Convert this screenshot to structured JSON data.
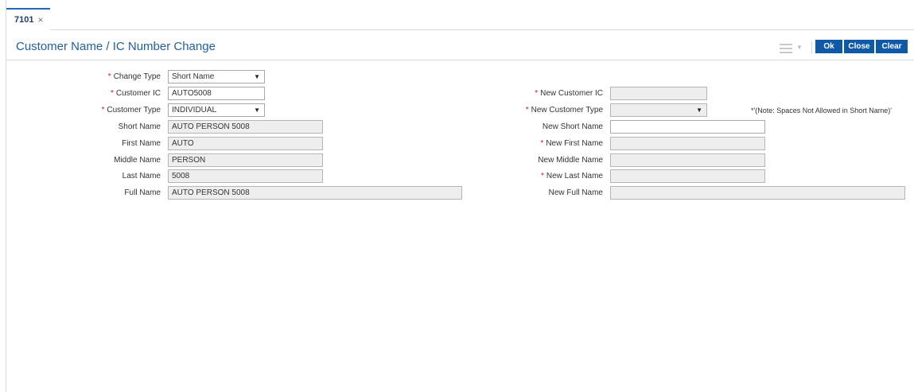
{
  "tab": {
    "label": "7101",
    "close": "×"
  },
  "header": {
    "title": "Customer Name / IC Number Change"
  },
  "toolbar": {
    "ok": "Ok",
    "close": "Close",
    "clear": "Clear"
  },
  "req_mark": "*",
  "form": {
    "change_type": {
      "label": "Change Type",
      "value": "Short Name"
    },
    "customer_ic": {
      "label": "Customer IC",
      "value": "AUTO5008"
    },
    "customer_type": {
      "label": "Customer Type",
      "value": "INDIVIDUAL"
    },
    "short_name": {
      "label": "Short Name",
      "value": "AUTO PERSON 5008"
    },
    "first_name": {
      "label": "First Name",
      "value": "AUTO"
    },
    "middle_name": {
      "label": "Middle Name",
      "value": "PERSON"
    },
    "last_name": {
      "label": "Last Name",
      "value": "5008"
    },
    "full_name": {
      "label": "Full Name",
      "value": "AUTO PERSON 5008"
    },
    "new_customer_ic": {
      "label": "New Customer IC",
      "value": ""
    },
    "new_customer_type": {
      "label": "New Customer Type",
      "value": ""
    },
    "new_short_name": {
      "label": "New Short Name",
      "value": ""
    },
    "new_first_name": {
      "label": "New First Name",
      "value": ""
    },
    "new_middle_name": {
      "label": "New Middle Name",
      "value": ""
    },
    "new_last_name": {
      "label": "New Last Name",
      "value": ""
    },
    "new_full_name": {
      "label": "New Full Name",
      "value": ""
    },
    "note": "*'(Note: Spaces Not Allowed in Short Name)'"
  },
  "icons": {
    "dropdown": "▼",
    "menu": "hamburger-menu"
  }
}
